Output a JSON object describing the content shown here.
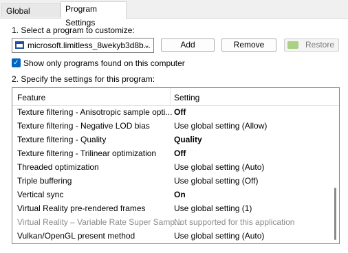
{
  "tabs": [
    {
      "label": "Global Settings"
    },
    {
      "label": "Program Settings"
    }
  ],
  "step1": {
    "label": "1. Select a program to customize:"
  },
  "program_select": {
    "value": "microsoft.limitless_8wekyb3d8b...",
    "icon": "app-window-icon"
  },
  "buttons": {
    "add": "Add",
    "remove": "Remove",
    "restore": "Restore"
  },
  "show_only": {
    "label": "Show only programs found on this computer",
    "checked": true
  },
  "step2": {
    "label": "2. Specify the settings for this program:"
  },
  "grid": {
    "headers": {
      "feature": "Feature",
      "setting": "Setting"
    },
    "rows": [
      {
        "feature": "Texture filtering - Anisotropic sample opti...",
        "setting": "Off",
        "bold": true
      },
      {
        "feature": "Texture filtering - Negative LOD bias",
        "setting": "Use global setting (Allow)",
        "bold": false
      },
      {
        "feature": "Texture filtering - Quality",
        "setting": "Quality",
        "bold": true
      },
      {
        "feature": "Texture filtering - Trilinear optimization",
        "setting": "Off",
        "bold": true
      },
      {
        "feature": "Threaded optimization",
        "setting": "Use global setting (Auto)",
        "bold": false
      },
      {
        "feature": "Triple buffering",
        "setting": "Use global setting (Off)",
        "bold": false
      },
      {
        "feature": "Vertical sync",
        "setting": "On",
        "bold": true
      },
      {
        "feature": "Virtual Reality pre-rendered frames",
        "setting": "Use global setting (1)",
        "bold": false
      },
      {
        "feature": "Virtual Reality – Variable Rate Super Samp...",
        "setting": "Not supported for this application",
        "disabled": true
      },
      {
        "feature": "Vulkan/OpenGL present method",
        "setting": "Use global setting (Auto)",
        "bold": false
      }
    ]
  }
}
